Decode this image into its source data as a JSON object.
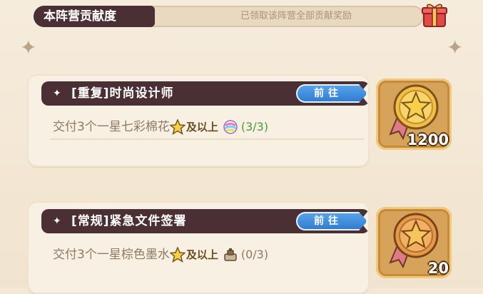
{
  "header": {
    "title": "本阵营贡献度",
    "status": "已领取该阵营全部贡献奖励"
  },
  "tasks": [
    {
      "title": "[重复]时尚设计师",
      "go_label": "前往",
      "desc_prefix": "交付3个一星七彩棉花",
      "quality": "及以上",
      "progress": "(3/3)",
      "item_icon": "rainbow-cotton-icon",
      "reward_value": "1200"
    },
    {
      "title": "[常规]紧急文件签署",
      "go_label": "前往",
      "desc_prefix": "交付3个一星棕色墨水",
      "quality": "及以上",
      "progress": "(0/3)",
      "item_icon": "brown-ink-icon",
      "reward_value": "20"
    }
  ],
  "colors": {
    "title_bar": "#4a3035",
    "go_button": "#3b86d8",
    "progress_complete": "#4a9a3b",
    "medal_gold": "#f2c04a",
    "medal_bronze": "#e59a4b"
  }
}
